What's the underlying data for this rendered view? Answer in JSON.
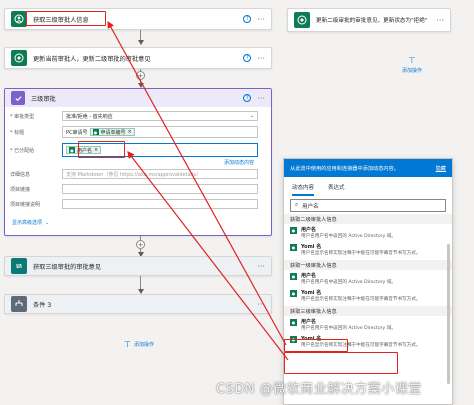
{
  "cards": {
    "get_info": {
      "title": "获取三级审批人信息",
      "help": "?",
      "menu": "···"
    },
    "update": {
      "title": "更新当前审批人，更新二级审批的审批意见",
      "help": "?",
      "menu": "···"
    },
    "approval": {
      "title": "三级审批",
      "help": "?",
      "menu": "···",
      "fields": {
        "type_label": "* 审批类型",
        "type_value": "批准/拒绝 - 首先响应",
        "title_label": "* 标题",
        "title_prefix": "PC审请号",
        "title_chip": "申请单编号",
        "assign_label": "* 已分配给",
        "assign_chip": "用户名",
        "add_dynamic": "添加动态内容",
        "details_label": "详细信息",
        "details_placeholder": "支持 Markdown（参见 https://aka.ms/approvaldetails）",
        "link_label": "项目链接",
        "link_desc_label": "项目链接说明",
        "advanced": "显示高级选项"
      }
    },
    "get_opinion": {
      "title": "获取三级审批的审批意见",
      "menu": "···"
    },
    "condition": {
      "title": "条件 3",
      "menu": "···"
    },
    "right_update": {
      "title": "更新二级审批的审批意见，更新状态为\"拒绝\"",
      "menu": "···"
    }
  },
  "add_action": "添加操作",
  "right_add_action": "添加操作",
  "panel": {
    "header": "从此流中使用的应用和连接器中添加动态内容。",
    "hide": "隐藏",
    "tabs": [
      "动态内容",
      "表达式"
    ],
    "search_value": "用户名",
    "groups": [
      {
        "label": "获取二级审批人信息",
        "items": [
          {
            "name": "用户名",
            "desc": "用户名用户名中返回的 Active Directory 域。"
          },
          {
            "name": "Yomi 名",
            "desc": "用户名显示名称实现注释于中能在可能字幕音节书写方式。"
          }
        ]
      },
      {
        "label": "获取一级审批人信息",
        "items": [
          {
            "name": "用户名",
            "desc": "用户名用户名中返回的 Active Directory 域。"
          },
          {
            "name": "Yomi 名",
            "desc": "用户名显示名称实现注释于中能在可能字幕音节书写方式。"
          }
        ]
      },
      {
        "label": "获取三级审批人信息",
        "items": [
          {
            "name": "用户名",
            "desc": "用户名用户名中返回的 Active Directory 域。"
          },
          {
            "name": "Yomi 名",
            "desc": "用户名显示名称实现注释于中能在可能字幕音节书写方式。"
          }
        ]
      }
    ]
  },
  "watermark": "CSDN @微软商业解决方案小课堂",
  "colors": {
    "accent": "#0078d4",
    "highlight": "#e0231f",
    "green": "#0f7b53",
    "purple": "#7b61c9"
  }
}
